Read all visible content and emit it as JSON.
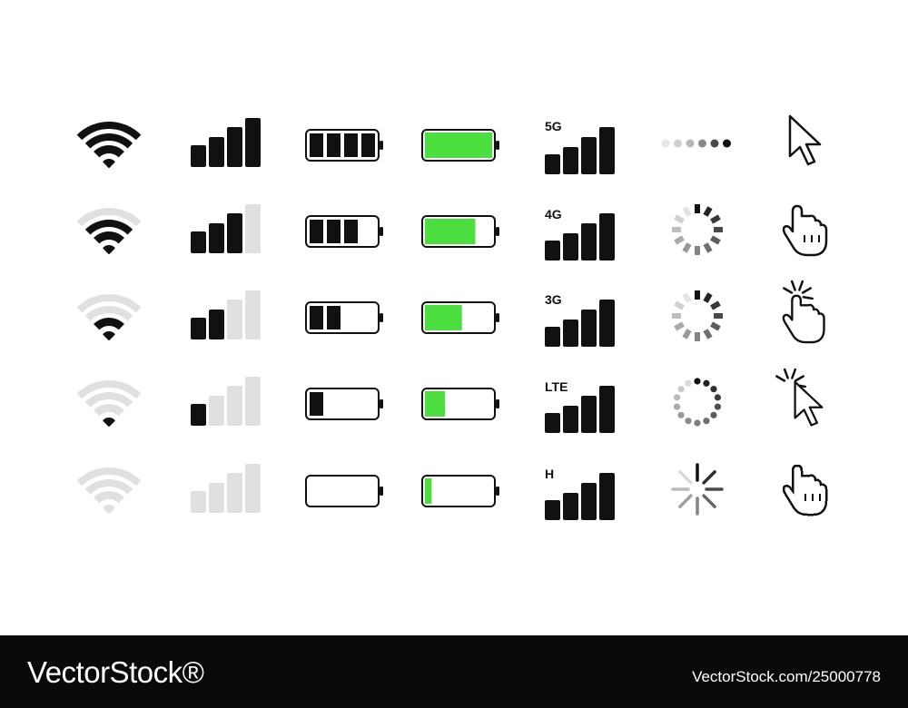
{
  "palette": {
    "dark": "#111111",
    "mid": "#a9a9a9",
    "light": "#e0e0e0",
    "battery_green": "#4cdd3f"
  },
  "wifi": {
    "levels": [
      3,
      2,
      1,
      0,
      -1
    ]
  },
  "signal": {
    "levels": [
      4,
      3,
      2,
      1,
      0
    ]
  },
  "battery_black": {
    "segments": [
      4,
      3,
      2,
      1,
      0
    ]
  },
  "battery_green": {
    "fills": [
      1.0,
      0.75,
      0.55,
      0.3,
      0.1
    ]
  },
  "network": {
    "labels": [
      "5G",
      "4G",
      "3G",
      "LTE",
      "H"
    ]
  },
  "loaders": {
    "styles": [
      "dots-row",
      "ring-segments",
      "ring-segments",
      "ring-dots",
      "burst"
    ]
  },
  "cursors": {
    "icons": [
      "arrow-cursor-icon",
      "hand-pointer-icon",
      "hand-click-icon",
      "arrow-click-icon",
      "pixel-hand-cursor-icon"
    ]
  },
  "footer": {
    "brand": "VectorStock®",
    "image_id": "VectorStock.com/25000778"
  }
}
